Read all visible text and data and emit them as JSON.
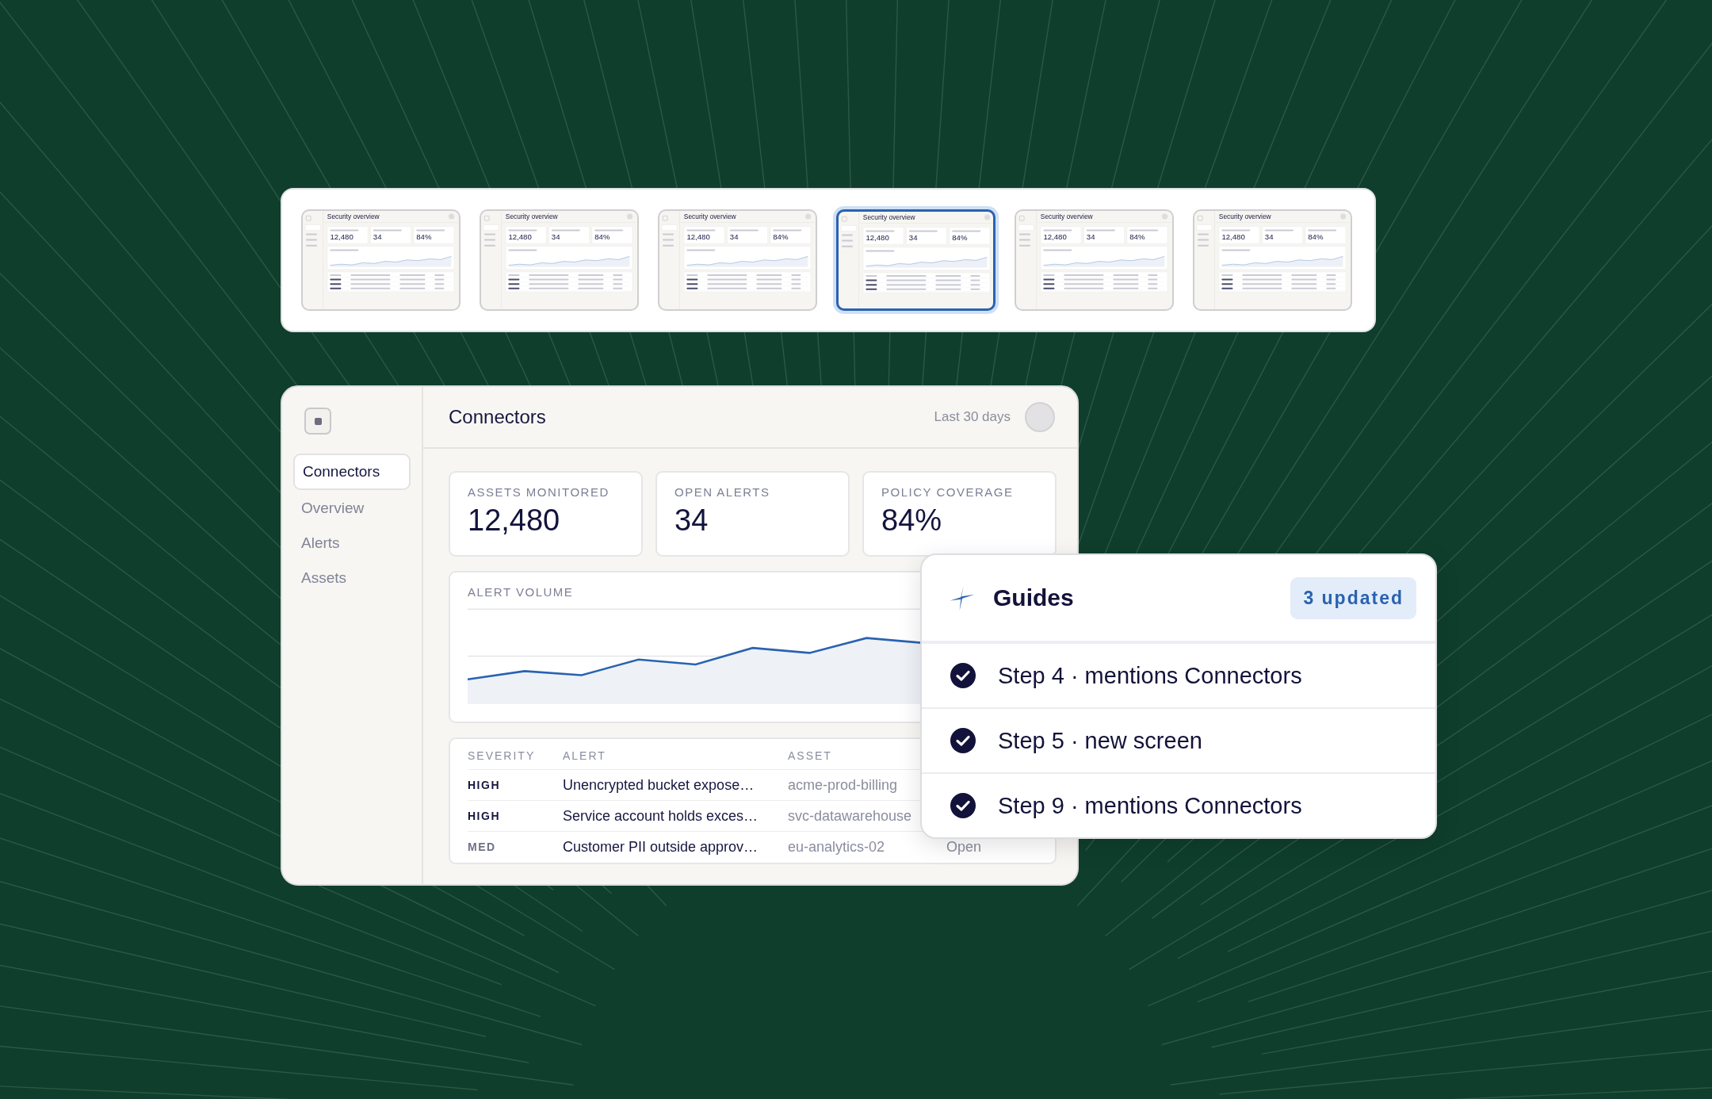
{
  "thumbnails": [
    {
      "selected": false,
      "title": "Security overview",
      "kpis": [
        "12,480",
        "34",
        "84%"
      ]
    },
    {
      "selected": false,
      "title": "Security overview",
      "kpis": [
        "12,480",
        "34",
        "84%"
      ]
    },
    {
      "selected": false,
      "title": "Security overview",
      "kpis": [
        "12,480",
        "34",
        "84%"
      ]
    },
    {
      "selected": true,
      "title": "Security overview",
      "kpis": [
        "12,480",
        "34",
        "84%"
      ]
    },
    {
      "selected": false,
      "title": "Security overview",
      "kpis": [
        "12,480",
        "34",
        "84%"
      ]
    },
    {
      "selected": false,
      "title": "Security overview",
      "kpis": [
        "12,480",
        "34",
        "84%"
      ]
    }
  ],
  "panel": {
    "title": "Connectors",
    "range": "Last 30 days",
    "nav": [
      {
        "label": "Connectors",
        "selected": true
      },
      {
        "label": "Overview",
        "selected": false
      },
      {
        "label": "Alerts",
        "selected": false
      },
      {
        "label": "Assets",
        "selected": false
      }
    ],
    "kpis": [
      {
        "label": "ASSETS MONITORED",
        "value": "12,480"
      },
      {
        "label": "OPEN ALERTS",
        "value": "34"
      },
      {
        "label": "POLICY COVERAGE",
        "value": "84%"
      }
    ],
    "chart_label": "ALERT VOLUME",
    "columns": [
      "SEVERITY",
      "ALERT",
      "ASSET"
    ],
    "rows": [
      {
        "severity": "HIGH",
        "alert": "Unencrypted bucket expose…",
        "asset": "acme-prod-billing"
      },
      {
        "severity": "HIGH",
        "alert": "Service account holds exces…",
        "asset": "svc-datawarehouse"
      },
      {
        "severity": "MED",
        "alert": "Customer PII outside approv…",
        "asset": "eu-analytics-02",
        "status": "Open"
      }
    ]
  },
  "guides": {
    "title": "Guides",
    "badge": "3 updated",
    "items": [
      {
        "label": "Step 4 · mentions Connectors",
        "checked": true
      },
      {
        "label": "Step 5 · new screen",
        "checked": true
      },
      {
        "label": "Step 9 · mentions Connectors",
        "checked": true
      }
    ]
  }
}
